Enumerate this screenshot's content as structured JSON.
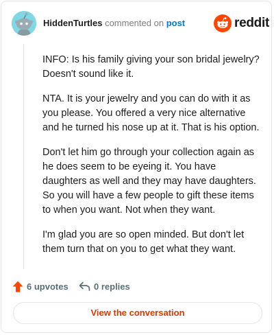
{
  "header": {
    "author": "HiddenTurtles",
    "action_text": "commented on",
    "post_link": "post",
    "logo_text": "reddit"
  },
  "comment": {
    "paragraphs": [
      "INFO: Is his family giving your son bridal jewelry? Doesn't sound like it.",
      "NTA. It is your jewelry and you can do with it as you please. You offered a very nice alternative and he turned his nose up at it. That is his option.",
      "Don't let him go through your collection again as he does seem to be eyeing it. You have daughters as well and they may have daughters. So you will have a few people to gift these items to when you want. Not when they want.",
      "I'm glad you are so open minded. But don't let them turn that on you to get what they want."
    ]
  },
  "footer": {
    "upvotes": "6 upvotes",
    "replies": "0 replies",
    "view_button": "View the conversation"
  },
  "icons": {
    "avatar": "snoo-avatar-icon",
    "logo": "reddit-logo-icon",
    "upvote": "upvote-arrow-icon",
    "reply": "reply-arrow-icon"
  },
  "colors": {
    "author": "#1c1c1c",
    "post_link": "#0079d3",
    "brand": "#ff4500",
    "button_text": "#d93a00",
    "avatar_bg": "#7fd8e4"
  }
}
